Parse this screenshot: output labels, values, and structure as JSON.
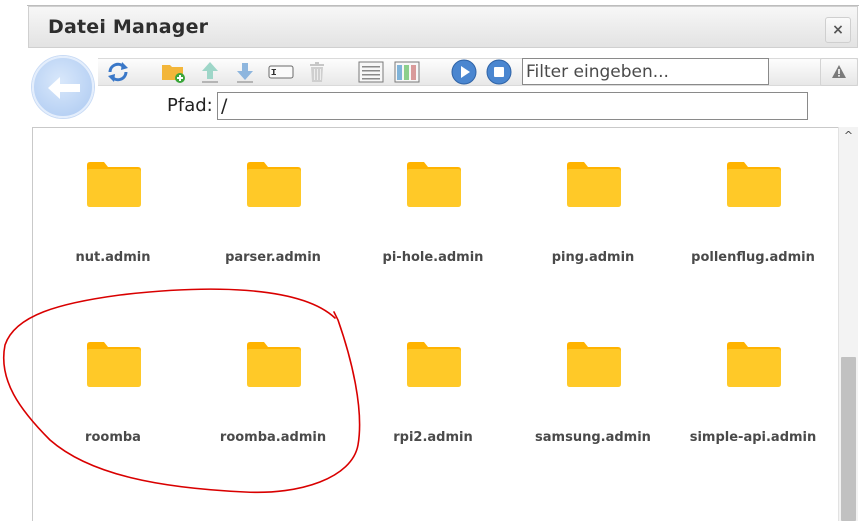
{
  "window": {
    "title": "Datei Manager",
    "close_label": "×"
  },
  "toolbar": {
    "buttons": [
      {
        "name": "refresh-button",
        "icon": "refresh-icon"
      },
      {
        "name": "new-folder-button",
        "icon": "new-folder-icon"
      },
      {
        "name": "upload-button",
        "icon": "upload-arrow-icon"
      },
      {
        "name": "download-button",
        "icon": "download-arrow-icon"
      },
      {
        "name": "rename-button",
        "icon": "rename-icon"
      },
      {
        "name": "delete-button",
        "icon": "trash-icon"
      },
      {
        "name": "list-view-button",
        "icon": "list-view-icon"
      },
      {
        "name": "table-view-button",
        "icon": "table-view-icon"
      },
      {
        "name": "play-button",
        "icon": "play-icon"
      },
      {
        "name": "stop-button",
        "icon": "stop-icon"
      }
    ],
    "filter_placeholder": "Filter eingeben...",
    "warning_icon": "warning-icon"
  },
  "path": {
    "label": "Pfad:",
    "value": "/"
  },
  "items": [
    {
      "label": "nut.admin"
    },
    {
      "label": "parser.admin"
    },
    {
      "label": "pi-hole.admin"
    },
    {
      "label": "ping.admin"
    },
    {
      "label": "pollenflug.admin"
    },
    {
      "label": "roomba"
    },
    {
      "label": "roomba.admin"
    },
    {
      "label": "rpi2.admin"
    },
    {
      "label": "samsung.admin"
    },
    {
      "label": "simple-api.admin"
    }
  ],
  "scrollbar": {
    "up_arrow": "^"
  },
  "colors": {
    "folder": "#ffc928",
    "folder_tab": "#ffb300",
    "annotation": "#d90000",
    "accent_blue": "#4a86d0"
  }
}
